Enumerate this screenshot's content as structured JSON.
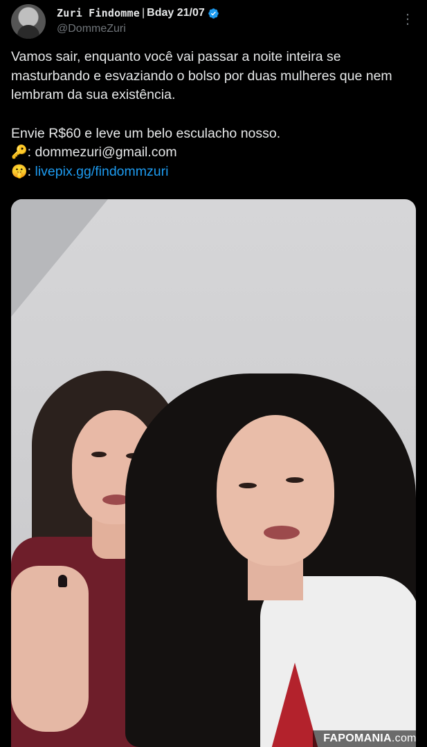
{
  "author": {
    "display_name": "Zuri Findomme",
    "separator": "|",
    "bday": "Bday 21/07",
    "handle": "@DommeZuri",
    "verified": true
  },
  "menu": {
    "more_icon": "⋮"
  },
  "tweet": {
    "text_line1": "Vamos sair, enquanto você vai passar a noite inteira se masturbando e esvaziando o bolso por duas mulheres que nem lembram da sua existência.",
    "text_line2": "Envie R$60 e leve um belo esculacho nosso.",
    "email_emoji": "🔑",
    "email_sep": ":",
    "email": "dommezuri@gmail.com",
    "link_emoji": "🤫",
    "link_sep": ":",
    "link": "livepix.gg/findommzuri"
  },
  "media": {
    "description_icon": "photo"
  },
  "watermark": {
    "brand": "FAPOMANIA",
    "tld": ".com"
  },
  "colors": {
    "background": "#000000",
    "text": "#e7e9ea",
    "secondary": "#71767b",
    "link": "#1d9bf0",
    "verified": "#1d9bf0"
  }
}
